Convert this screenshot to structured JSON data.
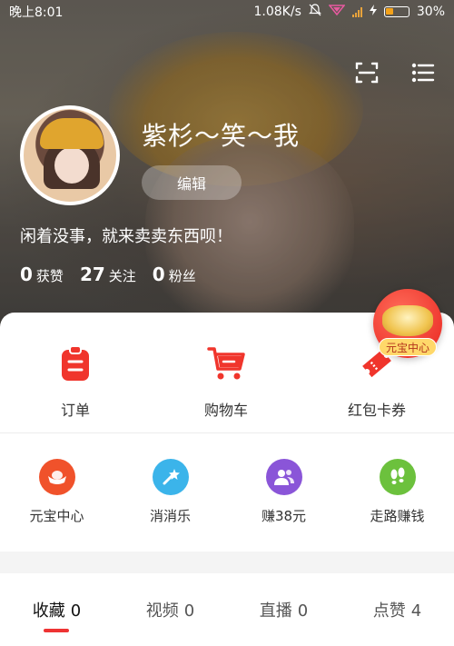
{
  "status_bar": {
    "time": "晚上8:01",
    "speed": "1.08K/s",
    "battery": "30%"
  },
  "profile": {
    "username": "紫杉～笑～我",
    "edit_label": "编辑",
    "bio": "闲着没事，就来卖卖东西呗！",
    "stats": [
      {
        "value": "0",
        "label": "获赞"
      },
      {
        "value": "27",
        "label": "关注"
      },
      {
        "value": "0",
        "label": "粉丝"
      }
    ]
  },
  "floating_badge": {
    "label": "元宝中心"
  },
  "primary_actions": [
    {
      "label": "订单",
      "icon": "order-clipboard-icon"
    },
    {
      "label": "购物车",
      "icon": "shopping-cart-icon"
    },
    {
      "label": "红包卡券",
      "icon": "coupon-ticket-icon"
    }
  ],
  "secondary_actions": [
    {
      "label": "元宝中心",
      "icon": "ingot-icon",
      "color": "#f0522b"
    },
    {
      "label": "消消乐",
      "icon": "sparkle-wand-icon",
      "color": "#3bb4ea"
    },
    {
      "label": "赚38元",
      "icon": "users-icon",
      "color": "#8a55d8"
    },
    {
      "label": "走路赚钱",
      "icon": "footprints-icon",
      "color": "#6cc13d"
    }
  ],
  "tabs": [
    {
      "label": "收藏",
      "count": "0"
    },
    {
      "label": "视频",
      "count": "0"
    },
    {
      "label": "直播",
      "count": "0"
    },
    {
      "label": "点赞",
      "count": "4"
    }
  ],
  "colors": {
    "accent": "#ee2a2a",
    "tab_indicator": "#e33333"
  }
}
